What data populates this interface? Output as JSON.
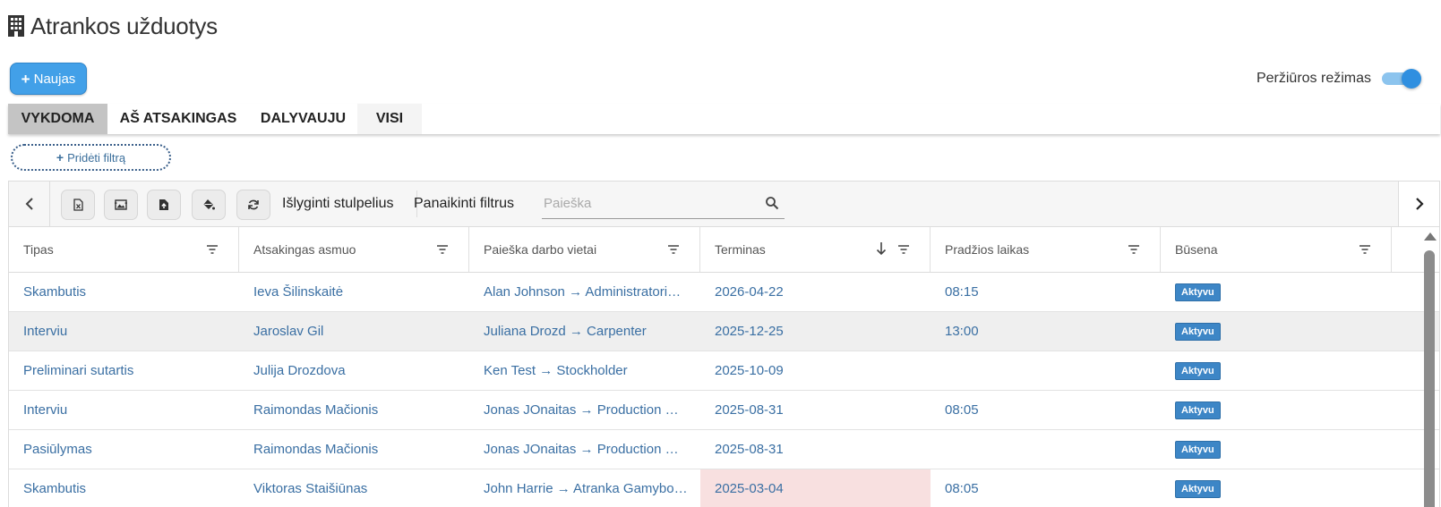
{
  "page": {
    "title": "Atrankos užduotys",
    "title_icon": "building-icon"
  },
  "actions": {
    "new_label": "Naujas"
  },
  "view_mode": {
    "label": "Peržiūros režimas",
    "enabled": true
  },
  "tabs": [
    {
      "label": "VYKDOMA",
      "active": true
    },
    {
      "label": "AŠ ATSAKINGAS",
      "active": false
    },
    {
      "label": "DALYVAUJU",
      "active": false
    },
    {
      "label": "VISI",
      "active": false
    }
  ],
  "filter": {
    "add_label": "Pridėti filtrą"
  },
  "toolbar": {
    "icons": [
      "excel-export-icon",
      "image-export-icon",
      "file-export-icon",
      "paint-bucket-icon",
      "refresh-icon"
    ],
    "align_columns_label": "Išlyginti stulpelius",
    "clear_filters_label": "Panaikinti filtrus",
    "search_placeholder": "Paieška",
    "search_value": ""
  },
  "table": {
    "columns": [
      "Tipas",
      "Atsakingas asmuo",
      "Paieška darbo vietai",
      "Terminas",
      "Pradžios laikas",
      "Būsena"
    ],
    "sorted_column": "Terminas",
    "sort_direction": "descending",
    "rows": [
      {
        "tipas": "Skambutis",
        "asmuo": "Ieva Šilinskaitė",
        "paieska": "Alan Johnson → Administratori…",
        "terminas": "2026-04-22",
        "laikas": "08:15",
        "busena": "Aktyvu",
        "overdue": false,
        "highlight": false
      },
      {
        "tipas": "Interviu",
        "asmuo": "Jaroslav Gil",
        "paieska": "Juliana Drozd → Carpenter",
        "terminas": "2025-12-25",
        "laikas": "13:00",
        "busena": "Aktyvu",
        "overdue": false,
        "highlight": true
      },
      {
        "tipas": "Preliminari sutartis",
        "asmuo": "Julija Drozdova",
        "paieska": "Ken Test → Stockholder",
        "terminas": "2025-10-09",
        "laikas": "",
        "busena": "Aktyvu",
        "overdue": false,
        "highlight": false
      },
      {
        "tipas": "Interviu",
        "asmuo": "Raimondas Mačionis",
        "paieska": "Jonas JOnaitas → Production …",
        "terminas": "2025-08-31",
        "laikas": "08:05",
        "busena": "Aktyvu",
        "overdue": false,
        "highlight": false
      },
      {
        "tipas": "Pasiūlymas",
        "asmuo": "Raimondas Mačionis",
        "paieska": "Jonas JOnaitas → Production …",
        "terminas": "2025-08-31",
        "laikas": "",
        "busena": "Aktyvu",
        "overdue": false,
        "highlight": false
      },
      {
        "tipas": "Skambutis",
        "asmuo": "Viktoras Staišiūnas",
        "paieska": "John Harrie → Atranka Gamybo…",
        "terminas": "2025-03-04",
        "laikas": "08:05",
        "busena": "Aktyvu",
        "overdue": true,
        "highlight": false
      }
    ]
  },
  "colors": {
    "accent": "#42a0e8",
    "link": "#3a6fa3",
    "badge": "#3d86c6",
    "overdue": "#f8e0e0",
    "active_tab": "#c4c4c4"
  }
}
